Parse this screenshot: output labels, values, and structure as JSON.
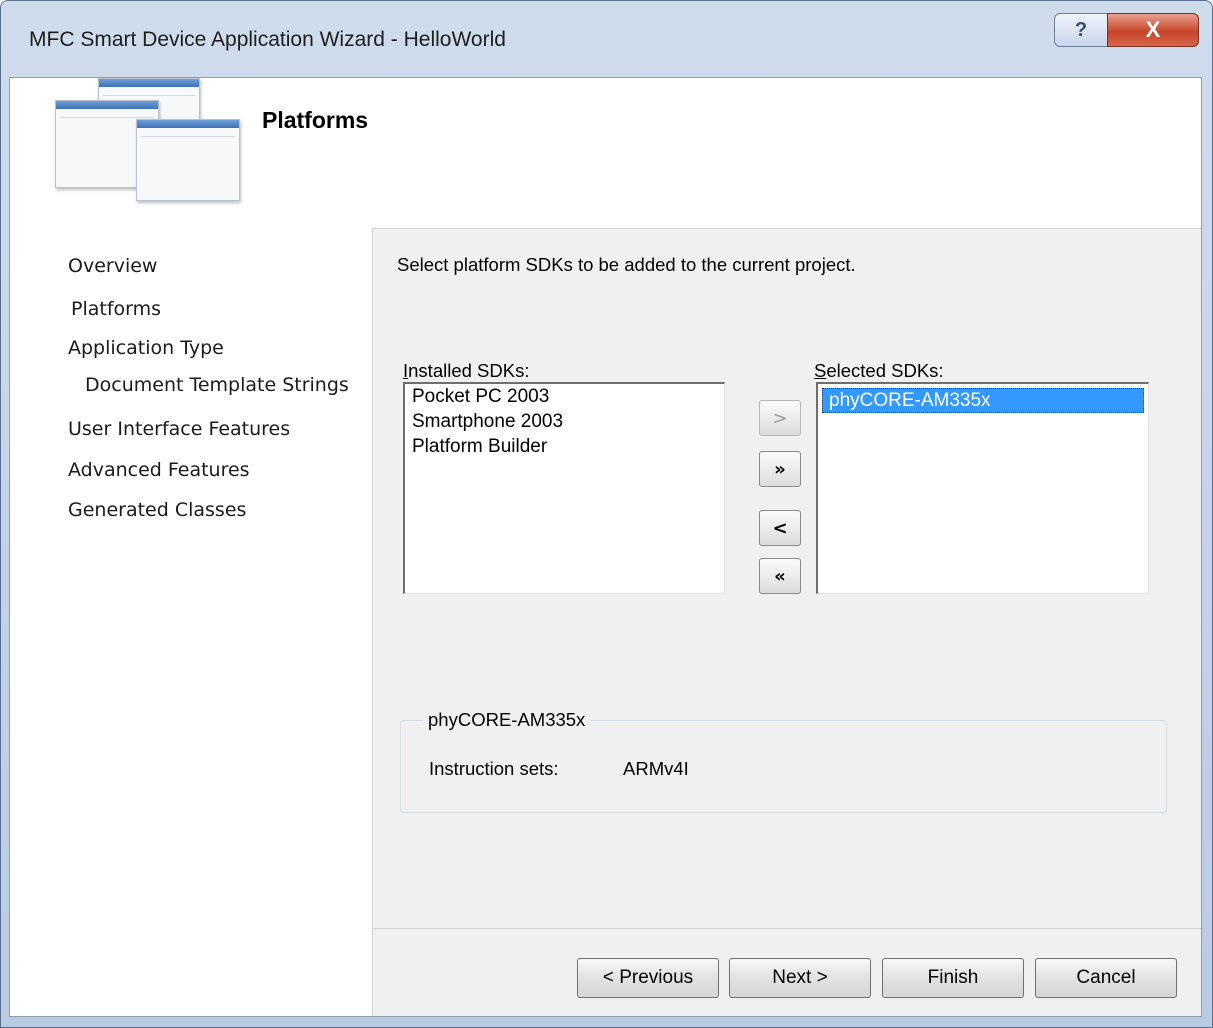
{
  "window": {
    "title": "MFC Smart Device Application Wizard - HelloWorld",
    "help_label": "?",
    "close_label": "X"
  },
  "banner": {
    "title": "Platforms",
    "icon": "wizard-windows-icon"
  },
  "nav": {
    "items": [
      {
        "label": "Overview"
      },
      {
        "label": "Platforms"
      },
      {
        "label": "Application Type"
      },
      {
        "label": "Document Template Strings"
      },
      {
        "label": "User Interface Features"
      },
      {
        "label": "Advanced Features"
      },
      {
        "label": "Generated Classes"
      }
    ]
  },
  "content": {
    "instruction": "Select platform SDKs to be added to the current project.",
    "installed": {
      "label_accel": "I",
      "label_rest": "nstalled SDKs:",
      "items": [
        "Pocket PC 2003",
        "Smartphone 2003",
        "Platform Builder"
      ]
    },
    "selected": {
      "label_accel": "S",
      "label_rest": "elected SDKs:",
      "items": [
        "phyCORE-AM335x"
      ]
    },
    "move_buttons": {
      "add": ">",
      "add_all": "»",
      "remove": "<",
      "remove_all": "«"
    },
    "details": {
      "group_title": "phyCORE-AM335x",
      "instruction_sets_label": "Instruction sets:",
      "instruction_sets_value": "ARMv4I"
    }
  },
  "footer": {
    "previous": "< Previous",
    "next": "Next >",
    "finish": "Finish",
    "cancel": "Cancel"
  }
}
